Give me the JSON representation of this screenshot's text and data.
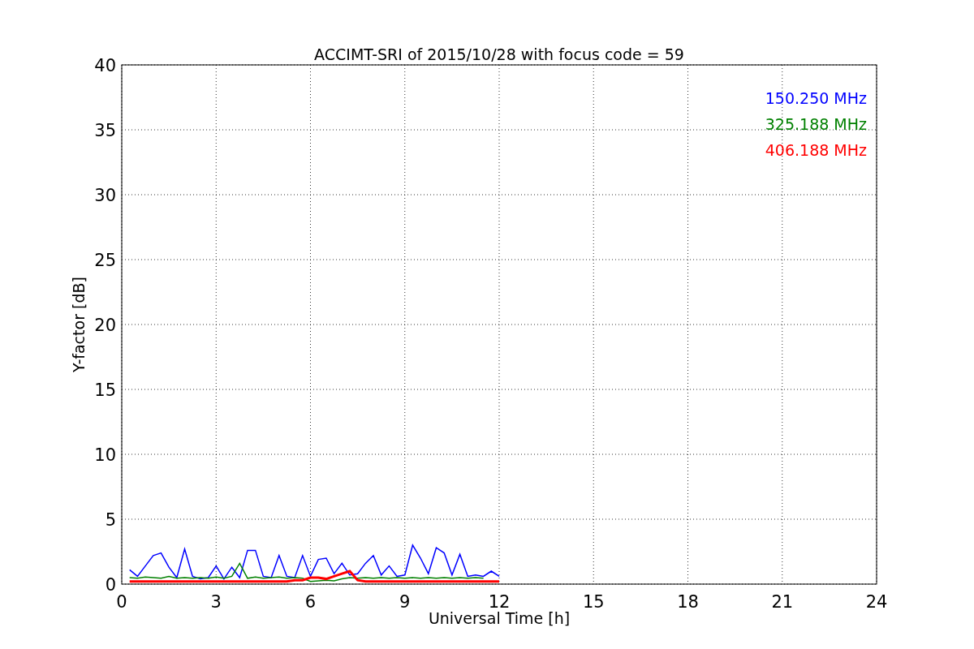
{
  "chart_data": {
    "type": "line",
    "title": "ACCIMT-SRI of 2015/10/28 with focus code = 59",
    "xlabel": "Universal Time [h]",
    "ylabel": "Y-factor [dB]",
    "x": [
      0.25,
      0.5,
      0.75,
      1.0,
      1.25,
      1.5,
      1.75,
      2.0,
      2.25,
      2.5,
      2.75,
      3.0,
      3.25,
      3.5,
      3.75,
      4.0,
      4.25,
      4.5,
      4.75,
      5.0,
      5.25,
      5.5,
      5.75,
      6.0,
      6.25,
      6.5,
      6.75,
      7.0,
      7.25,
      7.5,
      7.75,
      8.0,
      8.25,
      8.5,
      8.75,
      9.0,
      9.25,
      9.5,
      9.75,
      10.0,
      10.25,
      10.5,
      10.75,
      11.0,
      11.25,
      11.5,
      11.75,
      12.0
    ],
    "series": [
      {
        "name": "150.250 MHz",
        "color": "#0000ff",
        "values": [
          1.1,
          0.6,
          1.4,
          2.2,
          2.4,
          1.3,
          0.5,
          2.7,
          0.6,
          0.4,
          0.5,
          1.4,
          0.4,
          1.3,
          0.5,
          2.6,
          2.6,
          0.6,
          0.5,
          2.2,
          0.6,
          0.5,
          2.2,
          0.6,
          1.9,
          2.0,
          0.8,
          1.6,
          0.7,
          0.8,
          1.6,
          2.2,
          0.7,
          1.4,
          0.6,
          0.7,
          3.0,
          2.0,
          0.8,
          2.8,
          2.4,
          0.7,
          2.3,
          0.6,
          0.7,
          0.6,
          1.0,
          0.6
        ]
      },
      {
        "name": "325.188 MHz",
        "color": "#008000",
        "values": [
          0.5,
          0.45,
          0.55,
          0.5,
          0.45,
          0.6,
          0.45,
          0.5,
          0.45,
          0.5,
          0.45,
          0.55,
          0.45,
          0.6,
          1.6,
          0.45,
          0.55,
          0.45,
          0.5,
          0.55,
          0.45,
          0.5,
          0.45,
          0.2,
          0.25,
          0.3,
          0.25,
          0.4,
          0.5,
          0.45,
          0.5,
          0.45,
          0.5,
          0.45,
          0.5,
          0.45,
          0.5,
          0.45,
          0.5,
          0.45,
          0.5,
          0.45,
          0.5,
          0.45,
          0.5,
          0.45,
          null,
          null
        ]
      },
      {
        "name": "406.188 MHz",
        "color": "#ff0000",
        "values": [
          0.2,
          0.2,
          0.2,
          0.2,
          0.2,
          0.2,
          0.2,
          0.2,
          0.2,
          0.2,
          0.2,
          0.2,
          0.2,
          0.2,
          0.2,
          0.2,
          0.2,
          0.2,
          0.2,
          0.2,
          0.2,
          0.3,
          0.3,
          0.5,
          0.5,
          0.4,
          0.6,
          0.8,
          1.0,
          0.3,
          0.2,
          0.2,
          0.2,
          0.2,
          0.2,
          0.2,
          0.2,
          0.2,
          0.2,
          0.2,
          0.2,
          0.2,
          0.2,
          0.2,
          0.2,
          0.2,
          0.2,
          0.2
        ]
      }
    ],
    "grid": true,
    "xlim": [
      0,
      24
    ],
    "ylim": [
      0,
      40
    ],
    "xticks": [
      0,
      3,
      6,
      9,
      12,
      15,
      18,
      21,
      24
    ],
    "yticks": [
      0,
      5,
      10,
      15,
      20,
      25,
      30,
      35,
      40
    ]
  }
}
